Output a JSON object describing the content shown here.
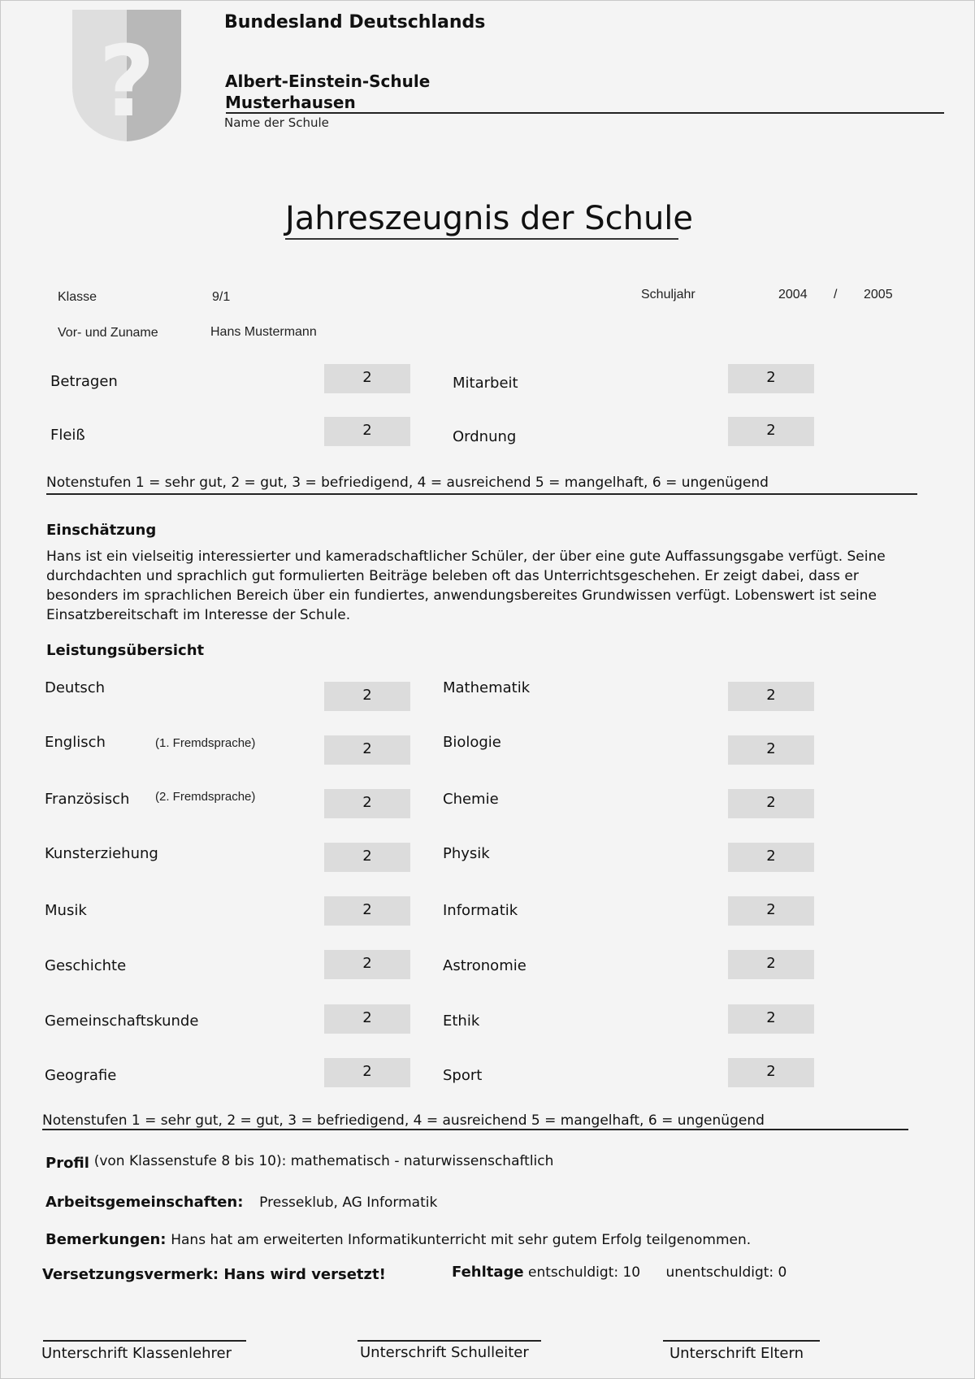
{
  "header": {
    "state": "Bundesland Deutschlands",
    "school_name_line1": "Albert-Einstein-Schule",
    "school_name_line2": "Musterhausen",
    "school_name_caption": "Name der Schule",
    "crest_icon": "question-shield-icon"
  },
  "title": "Jahreszeugnis der Schule",
  "info": {
    "class_label": "Klasse",
    "class_value": "9/1",
    "name_label": "Vor- und Zuname",
    "name_value": "Hans Mustermann",
    "year_label": "Schuljahr",
    "year_from": "2004",
    "year_sep": "/",
    "year_to": "2005"
  },
  "conduct": [
    {
      "label": "Betragen",
      "grade": "2"
    },
    {
      "label": "Mitarbeit",
      "grade": "2"
    },
    {
      "label": "Fleiß",
      "grade": "2"
    },
    {
      "label": "Ordnung",
      "grade": "2"
    }
  ],
  "grade_scale": "Notenstufen 1 = sehr gut, 2 = gut, 3 = befriedigend, 4 = ausreichend 5 = mangelhaft, 6 = ungenügend",
  "assessment": {
    "heading": "Einschätzung",
    "text": "Hans ist ein vielseitig interessierter und kameradschaftlicher Schüler, der über eine gute Auffassungsgabe verfügt. Seine durchdachten und sprachlich gut formulierten Beiträge beleben oft das Unterrichtsgeschehen. Er zeigt dabei, dass er besonders im sprachlichen Bereich über ein fundiertes, anwendungsbereites Grundwissen verfügt. Lobenswert ist seine Einsatzbereitschaft im Interesse der Schule."
  },
  "performance": {
    "heading": "Leistungsübersicht",
    "left": [
      {
        "subject": "Deutsch",
        "note": "",
        "grade": "2"
      },
      {
        "subject": "Englisch",
        "note": "(1. Fremdsprache)",
        "grade": "2"
      },
      {
        "subject": "Französisch",
        "note": "(2. Fremdsprache)",
        "grade": "2"
      },
      {
        "subject": "Kunsterziehung",
        "note": "",
        "grade": "2"
      },
      {
        "subject": "Musik",
        "note": "",
        "grade": "2"
      },
      {
        "subject": "Geschichte",
        "note": "",
        "grade": "2"
      },
      {
        "subject": "Gemeinschaftskunde",
        "note": "",
        "grade": "2"
      },
      {
        "subject": "Geografie",
        "note": "",
        "grade": "2"
      }
    ],
    "right": [
      {
        "subject": "Mathematik",
        "grade": "2"
      },
      {
        "subject": "Biologie",
        "grade": "2"
      },
      {
        "subject": "Chemie",
        "grade": "2"
      },
      {
        "subject": "Physik",
        "grade": "2"
      },
      {
        "subject": "Informatik",
        "grade": "2"
      },
      {
        "subject": "Astronomie",
        "grade": "2"
      },
      {
        "subject": "Ethik",
        "grade": "2"
      },
      {
        "subject": "Sport",
        "grade": "2"
      }
    ]
  },
  "profile": {
    "label": "Profil",
    "value": "(von Klassenstufe 8 bis 10): mathematisch - naturwissenschaftlich"
  },
  "clubs": {
    "label": "Arbeitsgemeinschaften:",
    "value": "Presseklub, AG Informatik"
  },
  "remarks": {
    "label": "Bemerkungen:",
    "value": "Hans hat am erweiterten Informatikunterricht mit sehr gutem Erfolg teilgenommen."
  },
  "promotion": {
    "text": "Versetzungsvermerk: Hans wird versetzt!"
  },
  "absence": {
    "label": "Fehltage",
    "excused": "entschuldigt: 10",
    "unexcused": "unentschuldigt: 0"
  },
  "signatures": [
    "Unterschrift Klassenlehrer",
    "Unterschrift Schulleiter",
    "Unterschrift Eltern"
  ]
}
